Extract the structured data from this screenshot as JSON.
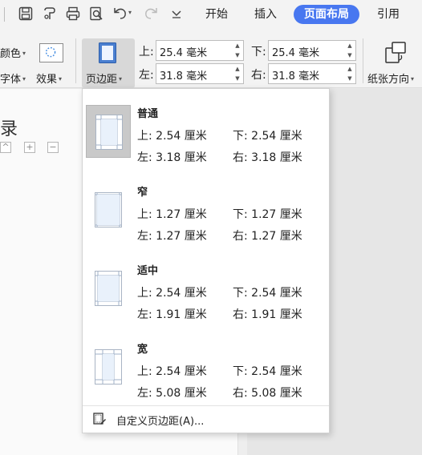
{
  "menu": {
    "tabs": [
      {
        "label": "开始"
      },
      {
        "label": "插入"
      },
      {
        "label": "页面布局"
      },
      {
        "label": "引用"
      }
    ],
    "active_color": "#4877f0"
  },
  "ribbon": {
    "color_label": "颜色",
    "font_label": "字体",
    "effect_label": "效果",
    "margins_label": "页边距",
    "top_label": "上:",
    "top_value": "25.4 毫米",
    "bottom_label": "下:",
    "bottom_value": "25.4 毫米",
    "left_label": "左:",
    "left_value": "31.8 毫米",
    "right_label": "右:",
    "right_value": "31.8 毫米",
    "orientation_label": "纸张方向"
  },
  "document": {
    "heading": "录"
  },
  "dropdown": {
    "presets": [
      {
        "name": "普通",
        "top": "上: 2.54 厘米",
        "bottom": "下: 2.54 厘米",
        "left": "左: 3.18 厘米",
        "right": "右: 3.18 厘米",
        "selected": true
      },
      {
        "name": "窄",
        "top": "上: 1.27 厘米",
        "bottom": "下: 1.27 厘米",
        "left": "左: 1.27 厘米",
        "right": "右: 1.27 厘米",
        "selected": false
      },
      {
        "name": "适中",
        "top": "上: 2.54 厘米",
        "bottom": "下: 2.54 厘米",
        "left": "左: 1.91 厘米",
        "right": "右: 1.91 厘米",
        "selected": false
      },
      {
        "name": "宽",
        "top": "上: 2.54 厘米",
        "bottom": "下: 2.54 厘米",
        "left": "左: 5.08 厘米",
        "right": "右: 5.08 厘米",
        "selected": false
      }
    ],
    "custom_label": "自定义页边距(A)..."
  }
}
